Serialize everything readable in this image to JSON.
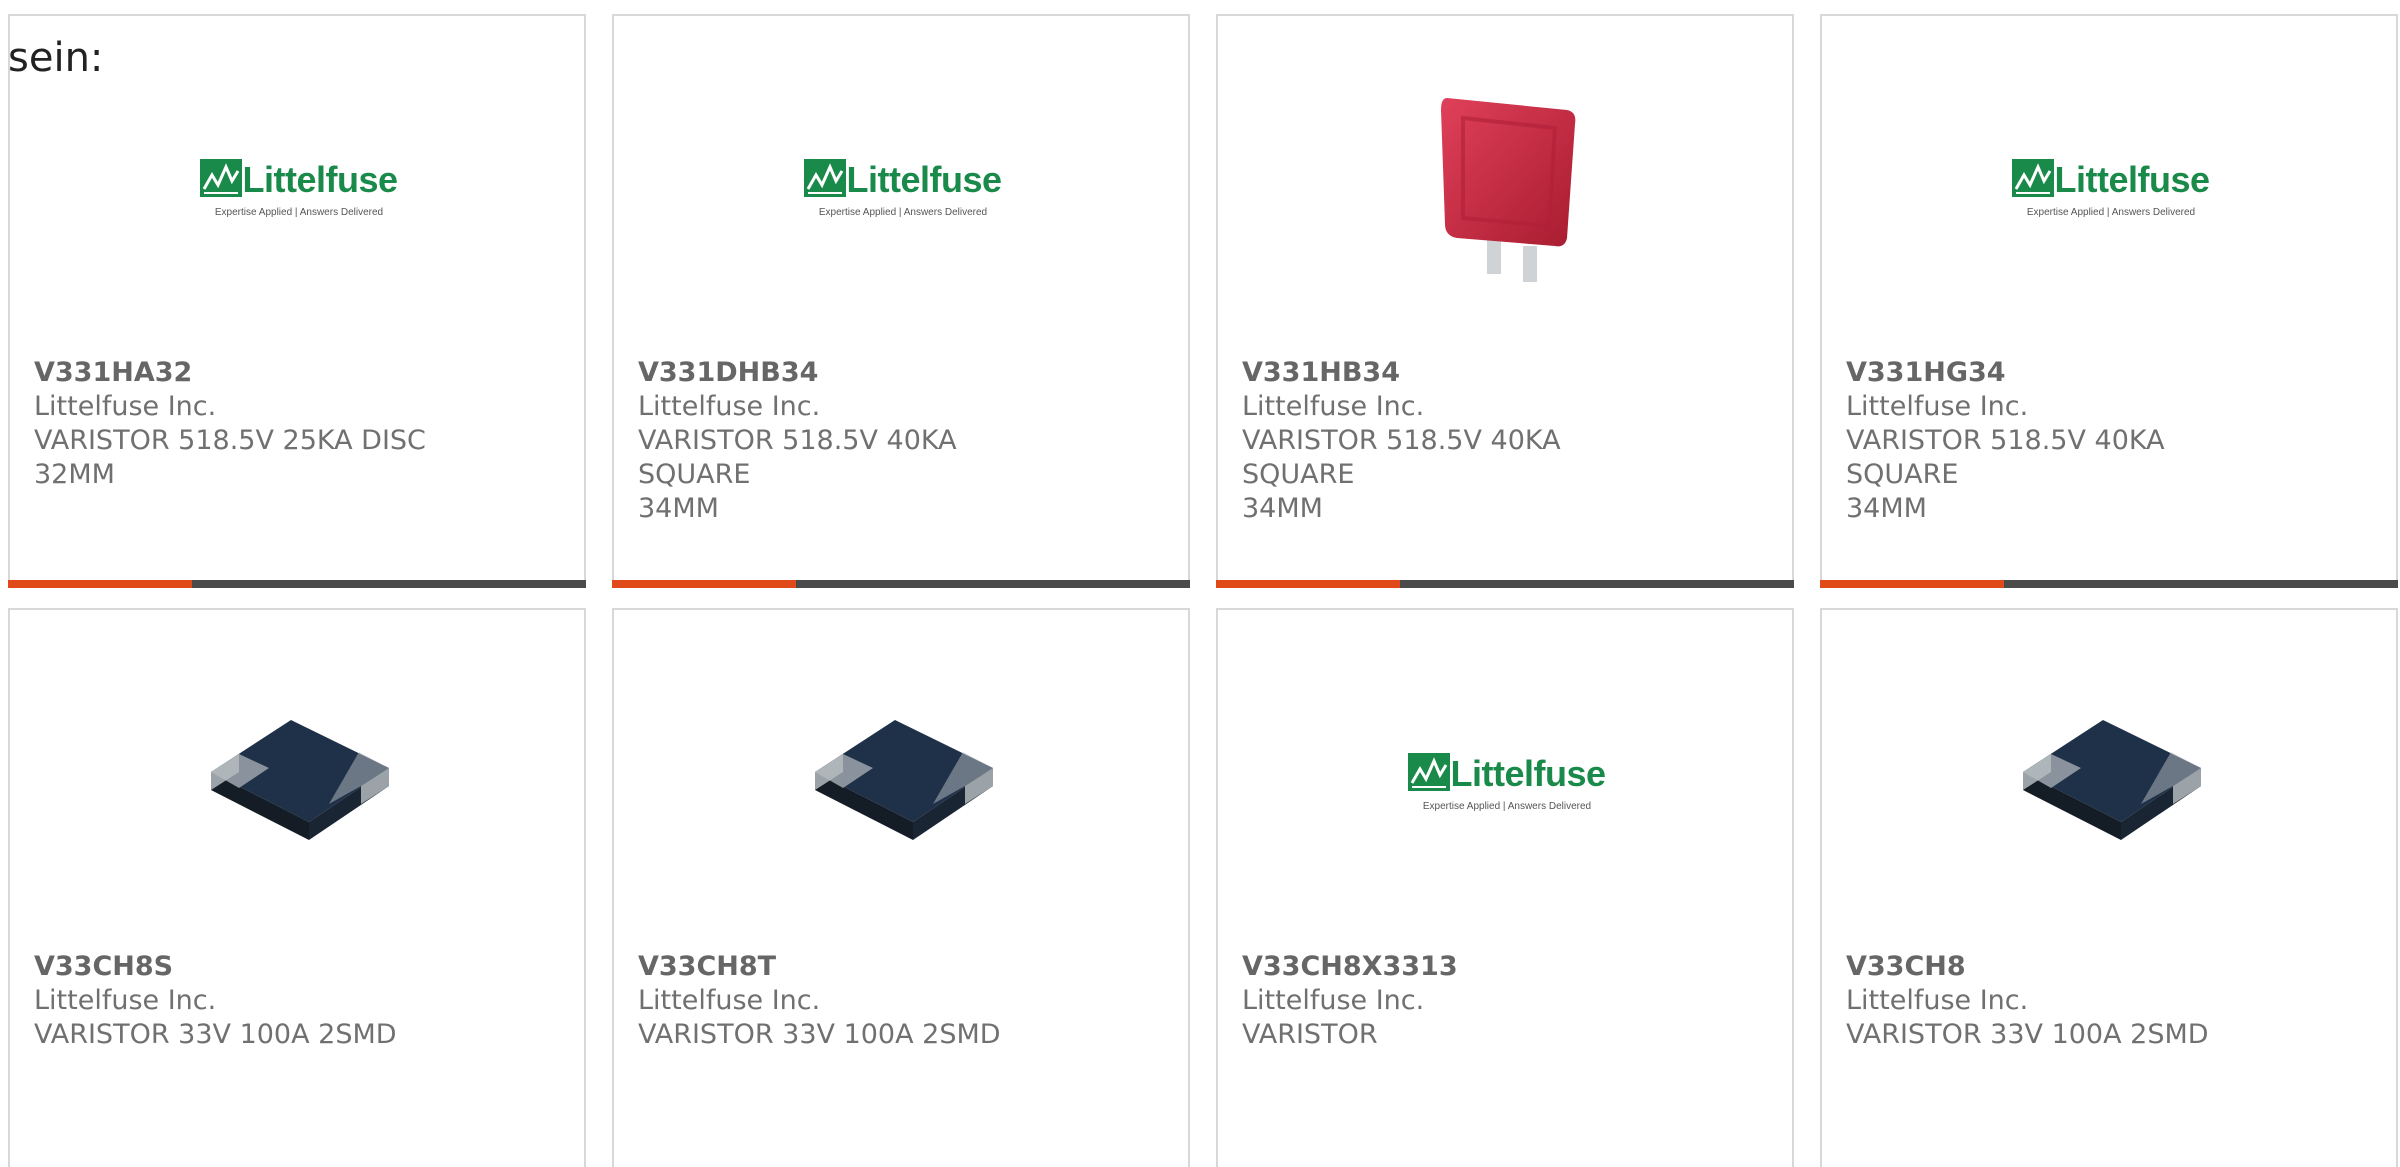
{
  "intro_text": "sein:",
  "logo": {
    "wordmark": "Littelfuse",
    "tagline": "Expertise Applied | Answers Delivered"
  },
  "colors": {
    "accent": "#e04a18",
    "bar": "#4a4a4a",
    "brand_green": "#1a8a4a",
    "varistor_red": "#c8283c",
    "chip_body": "#1f3148"
  },
  "products": [
    {
      "part_number": "V331HA32",
      "manufacturer": "Littelfuse Inc.",
      "desc_line1": "VARISTOR 518.5V 25KA DISC",
      "desc_line2": "32MM",
      "image": "littelfuse-logo"
    },
    {
      "part_number": "V331DHB34",
      "manufacturer": "Littelfuse Inc.",
      "desc_line1": "VARISTOR 518.5V 40KA SQUARE",
      "desc_line2": "34MM",
      "image": "littelfuse-logo"
    },
    {
      "part_number": "V331HB34",
      "manufacturer": "Littelfuse Inc.",
      "desc_line1": "VARISTOR 518.5V 40KA SQUARE",
      "desc_line2": "34MM",
      "image": "red-square-varistor"
    },
    {
      "part_number": "V331HG34",
      "manufacturer": "Littelfuse Inc.",
      "desc_line1": "VARISTOR 518.5V 40KA SQUARE",
      "desc_line2": "34MM",
      "image": "littelfuse-logo"
    },
    {
      "part_number": "V33CH8S",
      "manufacturer": "Littelfuse Inc.",
      "desc_line1": "VARISTOR 33V 100A 2SMD",
      "desc_line2": "",
      "image": "smd-chip"
    },
    {
      "part_number": "V33CH8T",
      "manufacturer": "Littelfuse Inc.",
      "desc_line1": "VARISTOR 33V 100A 2SMD",
      "desc_line2": "",
      "image": "smd-chip"
    },
    {
      "part_number": "V33CH8X3313",
      "manufacturer": "Littelfuse Inc.",
      "desc_line1": "VARISTOR",
      "desc_line2": "",
      "image": "littelfuse-logo"
    },
    {
      "part_number": "V33CH8",
      "manufacturer": "Littelfuse Inc.",
      "desc_line1": "VARISTOR 33V 100A 2SMD",
      "desc_line2": "",
      "image": "smd-chip"
    }
  ]
}
